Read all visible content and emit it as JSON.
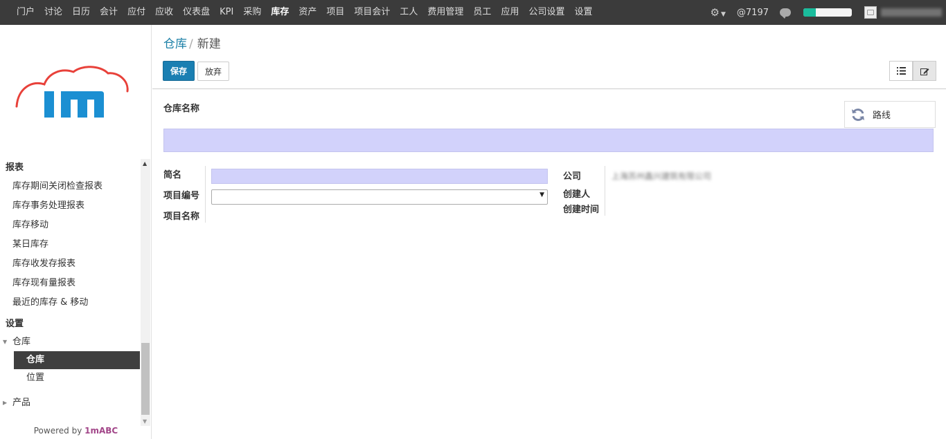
{
  "topnav": {
    "items": [
      "门户",
      "讨论",
      "日历",
      "会计",
      "应付",
      "应收",
      "仪表盘",
      "KPI",
      "采购",
      "库存",
      "资产",
      "项目",
      "项目会计",
      "工人",
      "费用管理",
      "员工",
      "应用",
      "公司设置",
      "设置"
    ],
    "active_index": 9,
    "mention_count": "@7197",
    "progress_percent": 25,
    "progress_color": "#1abc9c"
  },
  "sidebar": {
    "sections": [
      {
        "title": "报表",
        "items": [
          "库存期间关闭检查报表",
          "库存事务处理报表",
          "库存移动",
          "某日库存",
          "库存收发存报表",
          "库存现有量报表",
          "最近的库存 & 移动"
        ]
      },
      {
        "title": "设置"
      }
    ],
    "tree": [
      {
        "label": "仓库",
        "expanded": true,
        "children": [
          "仓库",
          "位置"
        ],
        "active_child": 0
      },
      {
        "label": "产品",
        "expanded": false
      }
    ],
    "footer_prefix": "Powered by",
    "footer_brand": "1mABC",
    "logo_text": "1m"
  },
  "breadcrumb": {
    "parent": "仓库",
    "current": "新建"
  },
  "toolbar": {
    "save_label": "保存",
    "discard_label": "放弃"
  },
  "form": {
    "name_label": "仓库名称",
    "name_value": "",
    "route_button": "路线",
    "fields_left": [
      {
        "label": "简名",
        "value": ""
      },
      {
        "label": "项目编号",
        "value": ""
      },
      {
        "label": "项目名称",
        "value": ""
      }
    ],
    "fields_right": [
      {
        "label": "公司",
        "value": "上海苏州鑫兴建筑有限公司"
      },
      {
        "label": "创建人",
        "value": ""
      },
      {
        "label": "创建时间",
        "value": ""
      }
    ]
  },
  "colors": {
    "topbar": "#3b3b3b",
    "primary": "#1a7fb2",
    "required_field": "#d2d2fb",
    "brand": "#a24689",
    "logo_blue": "#1b8fd2",
    "logo_red": "#e8413a"
  }
}
